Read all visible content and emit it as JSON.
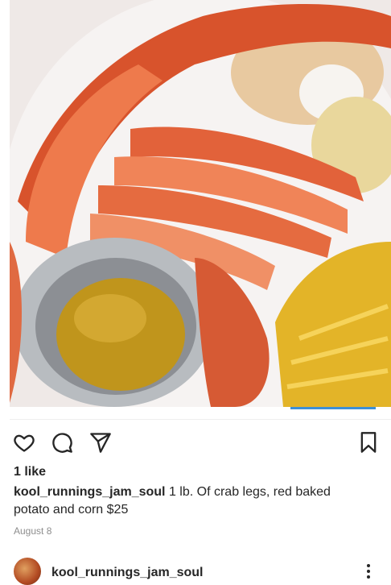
{
  "post": {
    "image_description": "",
    "likes": "1 like",
    "username": "kool_runnings_jam_soul",
    "caption": "1 lb. Of crab legs, red baked potato and corn $25",
    "date": "August 8"
  },
  "footer": {
    "username": "kool_runnings_jam_soul"
  },
  "icons": {
    "like": "heart-icon",
    "comment": "comment-icon",
    "share": "send-icon",
    "save": "bookmark-icon",
    "more": "more-vertical-icon"
  },
  "colors": {
    "indicator": "#3d8fd6",
    "text": "#262626",
    "muted": "#8e8e8e"
  }
}
